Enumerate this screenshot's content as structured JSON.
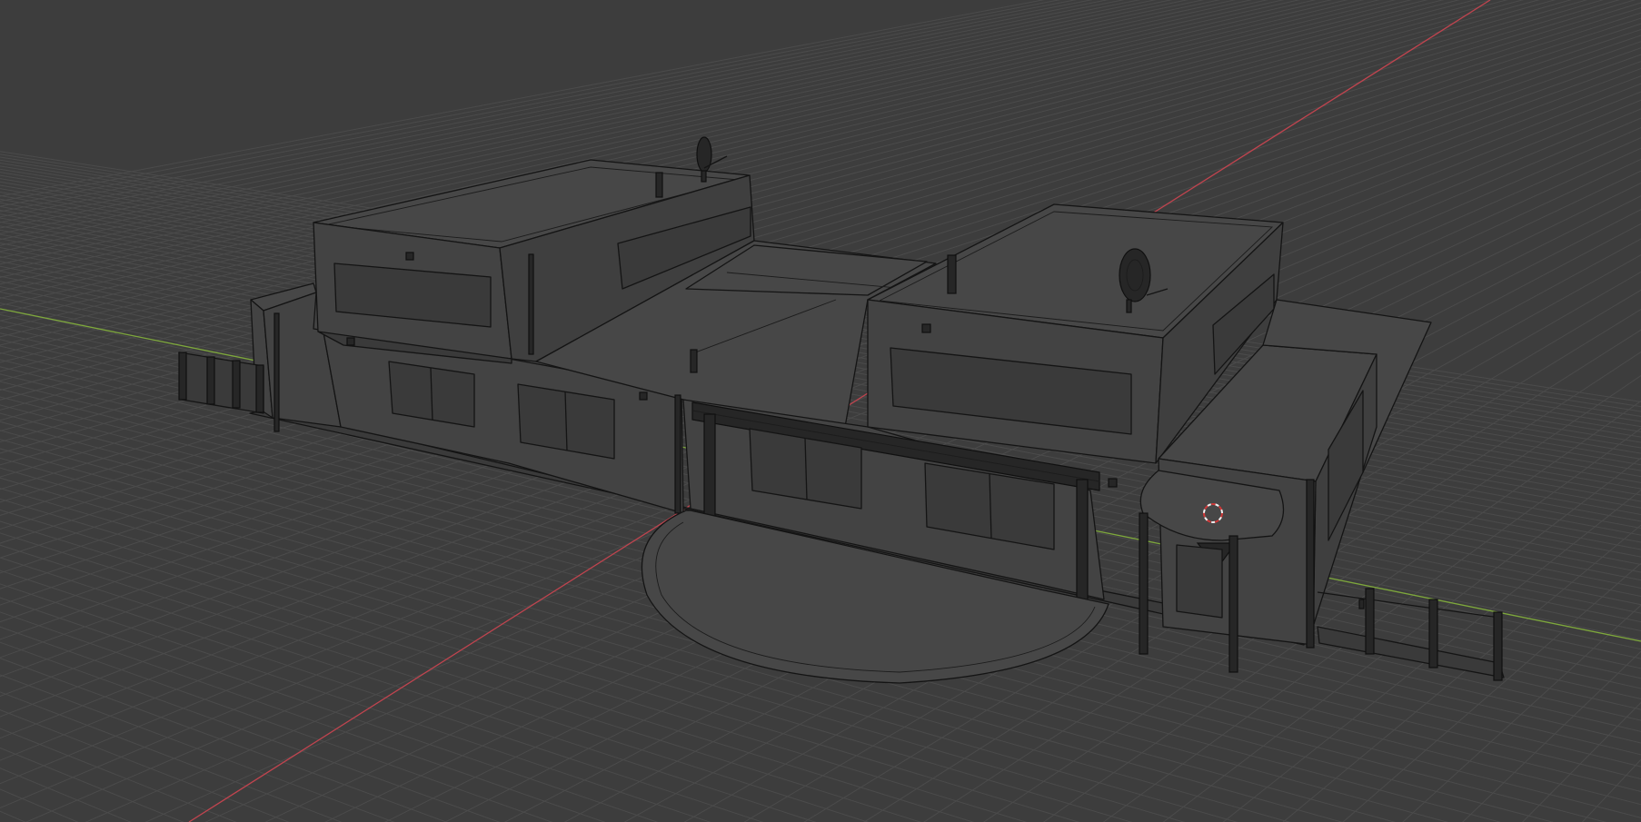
{
  "viewport": {
    "background_color": "#3d3d3d",
    "grid_color": "#4b4b4b",
    "wire_color": "#141414",
    "x_axis_color": "#c0444f",
    "y_axis_color": "#7ea83c",
    "cursor_color": "#d03838",
    "shading_mode": "solid-wireframe",
    "objects": [
      "floor-grid",
      "x-axis-line",
      "y-axis-line",
      "house-model",
      "left-fence",
      "right-fence",
      "satellite-dish-left",
      "satellite-dish-right",
      "3d-cursor-icon"
    ]
  }
}
